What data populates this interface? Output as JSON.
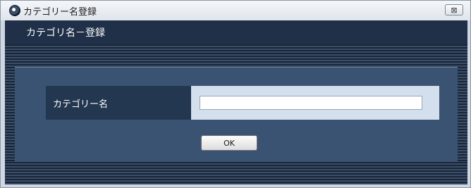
{
  "window": {
    "title": "カテゴリー名登録",
    "close_label": "⊠"
  },
  "header": {
    "title": "カテゴリ名－登録"
  },
  "form": {
    "label": "カテゴリー名",
    "input_value": "",
    "ok_label": "OK"
  },
  "colors": {
    "header_bg": "#1f3048",
    "panel_bg": "#3a5373",
    "label_bg": "#233750",
    "input_cell_bg": "#d4dfee"
  }
}
